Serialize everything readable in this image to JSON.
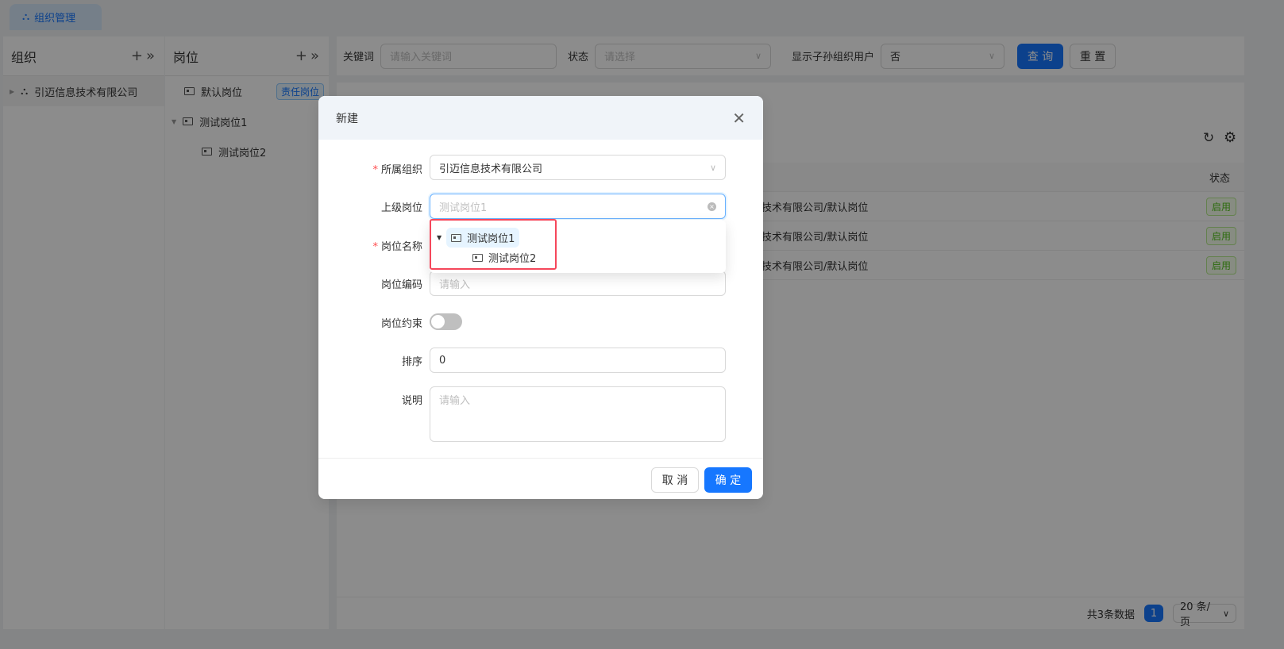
{
  "tab": {
    "label": "组织管理",
    "icon": "org-tree-icon"
  },
  "org_panel": {
    "title": "组织",
    "items": [
      {
        "label": "引迈信息技术有限公司"
      }
    ]
  },
  "post_panel": {
    "title": "岗位",
    "items": [
      {
        "label": "默认岗位",
        "tag": "责任岗位"
      },
      {
        "label": "测试岗位1"
      },
      {
        "label": "测试岗位2"
      }
    ]
  },
  "search": {
    "keyword_label": "关键词",
    "keyword_placeholder": "请输入关键词",
    "status_label": "状态",
    "status_placeholder": "请选择",
    "sub_label": "显示子孙组织用户",
    "sub_value": "否",
    "query": "查 询",
    "reset": "重 置"
  },
  "table": {
    "status_header": "状态",
    "rows": [
      {
        "path": "技术有限公司/默认岗位",
        "status": "启用"
      },
      {
        "path": "技术有限公司/默认岗位",
        "status": "启用"
      },
      {
        "path": "技术有限公司/默认岗位",
        "status": "启用"
      }
    ]
  },
  "pagination": {
    "total": "共3条数据",
    "page": "1",
    "page_size": "20 条/页"
  },
  "modal": {
    "title": "新建",
    "fields": {
      "org_label": "所属组织",
      "org_value": "引迈信息技术有限公司",
      "parent_label": "上级岗位",
      "parent_placeholder": "测试岗位1",
      "name_label": "岗位名称",
      "code_label": "岗位编码",
      "code_placeholder": "请输入",
      "constraint_label": "岗位约束",
      "constraint_on": false,
      "sort_label": "排序",
      "sort_value": "0",
      "desc_label": "说明",
      "desc_placeholder": "请输入"
    },
    "dropdown": [
      {
        "label": "测试岗位1",
        "selected": true
      },
      {
        "label": "测试岗位2"
      }
    ],
    "cancel": "取 消",
    "ok": "确 定"
  },
  "colors": {
    "primary": "#1677ff",
    "highlight": "#f5475b",
    "success": "#52c41a"
  }
}
